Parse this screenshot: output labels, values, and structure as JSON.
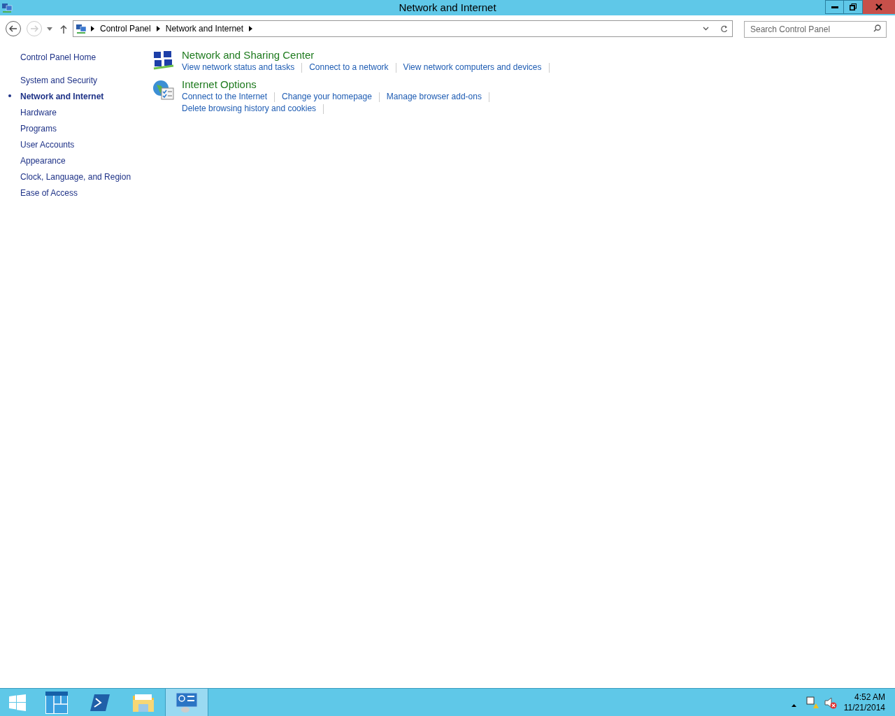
{
  "window": {
    "title": "Network and Internet"
  },
  "address_bar": {
    "breadcrumbs": [
      "Control Panel",
      "Network and Internet"
    ]
  },
  "search": {
    "placeholder": "Search Control Panel"
  },
  "sidebar": {
    "home": "Control Panel Home",
    "items": [
      {
        "label": "System and Security",
        "selected": false
      },
      {
        "label": "Network and Internet",
        "selected": true
      },
      {
        "label": "Hardware",
        "selected": false
      },
      {
        "label": "Programs",
        "selected": false
      },
      {
        "label": "User Accounts",
        "selected": false
      },
      {
        "label": "Appearance",
        "selected": false
      },
      {
        "label": "Clock, Language, and Region",
        "selected": false
      },
      {
        "label": "Ease of Access",
        "selected": false
      }
    ]
  },
  "sections": [
    {
      "kind": "network",
      "title": "Network and Sharing Center",
      "links": [
        "View network status and tasks",
        "Connect to a network",
        "View network computers and devices"
      ]
    },
    {
      "kind": "internet",
      "title": "Internet Options",
      "links": [
        "Connect to the Internet",
        "Change your homepage",
        "Manage browser add-ons",
        "Delete browsing history and cookies"
      ]
    }
  ],
  "taskbar": {
    "apps": [
      {
        "kind": "server-manager",
        "selected": false
      },
      {
        "kind": "powershell",
        "selected": false
      },
      {
        "kind": "explorer",
        "selected": false
      },
      {
        "kind": "control-panel",
        "selected": true
      }
    ],
    "clock": {
      "time": "4:52 AM",
      "date": "11/21/2014"
    }
  }
}
